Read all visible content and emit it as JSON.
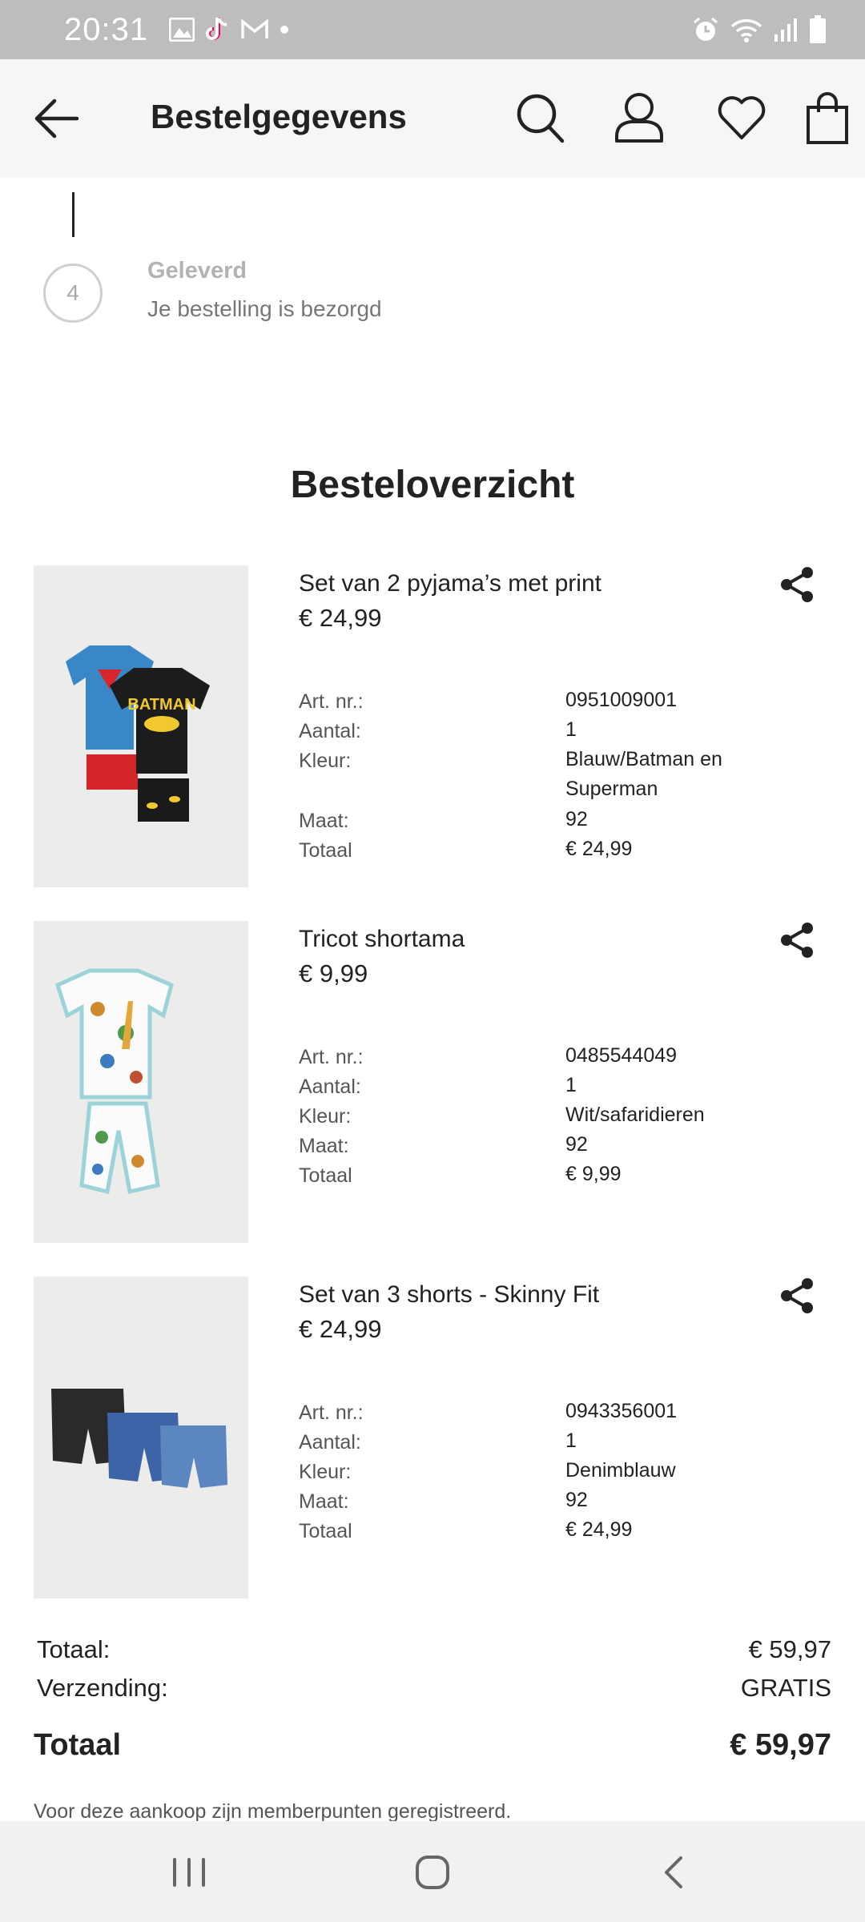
{
  "status_bar": {
    "time": "20:31",
    "left_icons": [
      "gallery-icon",
      "tiktok-icon",
      "gmail-icon",
      "dot-icon"
    ],
    "right_icons": [
      "alarm-icon",
      "wifi-icon",
      "signal-icon",
      "battery-icon"
    ]
  },
  "header": {
    "title": "Bestelgegevens",
    "icons": [
      "back-arrow-icon",
      "search-icon",
      "account-icon",
      "favorites-heart-icon",
      "shopping-bag-icon"
    ]
  },
  "tracking": {
    "step_number": "4",
    "step_title": "Geleverd",
    "step_description": "Je bestelling is bezorgd"
  },
  "overview": {
    "title": "Besteloverzicht",
    "labels": {
      "article": "Art. nr.:",
      "quantity": "Aantal:",
      "color": "Kleur:",
      "size": "Maat:",
      "total": "Totaal"
    },
    "items": [
      {
        "name": "Set van 2 pyjama’s met print",
        "price": "€ 24,99",
        "article": "0951009001",
        "quantity": "1",
        "color": "Blauw/Batman en Superman",
        "size": "92",
        "total": "€ 24,99",
        "image": "pyjama-superman-batman-image"
      },
      {
        "name": "Tricot shortama",
        "price": "€ 9,99",
        "article": "0485544049",
        "quantity": "1",
        "color": "Wit/safaridieren",
        "size": "92",
        "total": "€ 9,99",
        "image": "safari-shortama-image"
      },
      {
        "name": "Set van 3 shorts - Skinny Fit",
        "price": "€ 24,99",
        "article": "0943356001",
        "quantity": "1",
        "color": "Denimblauw",
        "size": "92",
        "total": "€ 24,99",
        "image": "denim-shorts-image"
      }
    ]
  },
  "totals": {
    "subtotal_label": "Totaal:",
    "subtotal_value": "€ 59,97",
    "shipping_label": "Verzending:",
    "shipping_value": "GRATIS",
    "grand_label": "Totaal",
    "grand_value": "€ 59,97",
    "member_note": "Voor deze aankoop zijn memberpunten geregistreerd."
  },
  "nav_bar": {
    "icons": [
      "recent-apps-icon",
      "home-icon",
      "back-icon"
    ]
  }
}
